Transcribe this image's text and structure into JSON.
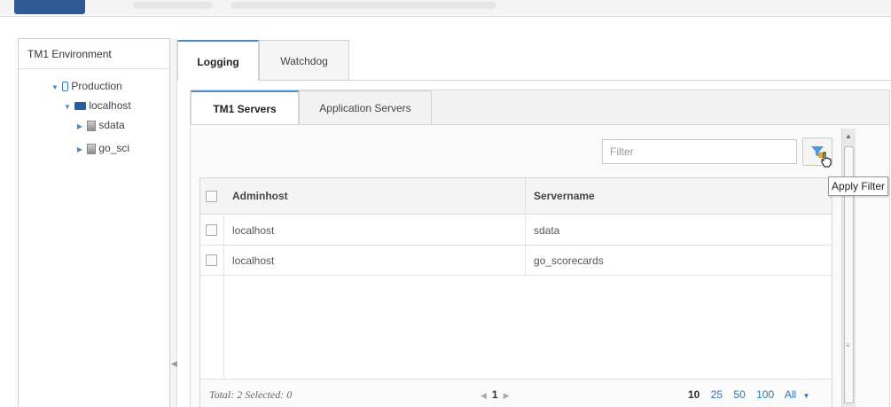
{
  "environment": {
    "title": "TM1 Environment",
    "tree": [
      {
        "label": "Production"
      },
      {
        "label": "localhost"
      },
      {
        "label": "sdata"
      },
      {
        "label": "go_sci"
      }
    ]
  },
  "outer_tabs": [
    {
      "label": "Logging",
      "active": true
    },
    {
      "label": "Watchdog",
      "active": false
    }
  ],
  "inner_tabs": [
    {
      "label": "TM1 Servers",
      "active": true
    },
    {
      "label": "Application Servers",
      "active": false
    }
  ],
  "filter": {
    "placeholder": "Filter",
    "tooltip": "Apply Filter"
  },
  "table": {
    "columns": [
      "Adminhost",
      "Servername"
    ],
    "rows": [
      [
        "localhost",
        "sdata"
      ],
      [
        "localhost",
        "go_scorecards"
      ]
    ]
  },
  "footer": {
    "summary": "Total: 2 Selected: 0",
    "current_page": "1",
    "page_sizes": [
      "10",
      "25",
      "50",
      "100",
      "All"
    ],
    "selected_page_size": "10"
  },
  "colors": {
    "accent": "#4a8cc9",
    "link": "#2e74b8",
    "brand_bar": "#2f5d93"
  },
  "icons": [
    "folder-icon",
    "host-icon",
    "server-icon",
    "filter-icon",
    "hand-cursor-icon",
    "chevron-down-icon",
    "chevron-right-icon"
  ]
}
